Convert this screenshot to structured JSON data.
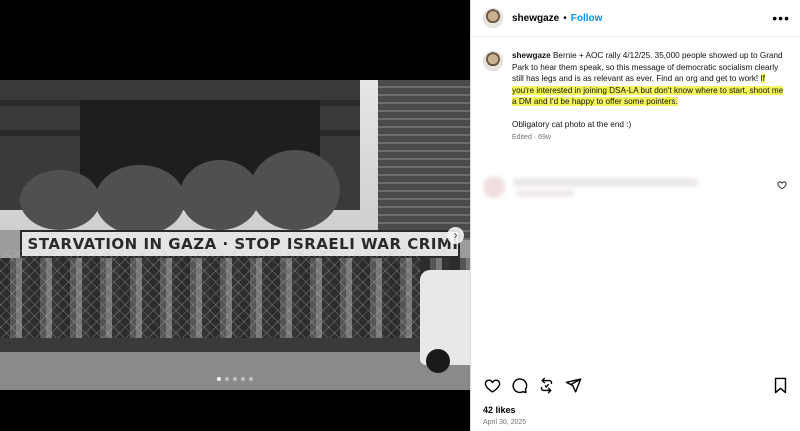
{
  "header": {
    "username": "shewgaze",
    "separator": "•",
    "follow_label": "Follow",
    "more_label": "•••"
  },
  "caption": {
    "username": "shewgaze",
    "text_plain": " Bernie + AOC rally 4/12/25. 35,000 people showed up to Grand Park to hear them speak, so this message of democratic socialism clearly still has legs and is as relevant as ever. Find an org and get to work! ",
    "text_highlighted": "If you're interested in joining DSA-LA but don't know where to start, shoot me a DM and I'd be happy to offer some pointers.",
    "extra": "Obligatory cat photo at the end :)",
    "meta": "Edited · 69w"
  },
  "media": {
    "banner_text": "STOP STARVATION IN GAZA · STOP ISRAELI WAR CRIMINALS",
    "next_icon": "›",
    "carousel_count": 5,
    "carousel_active": 0
  },
  "actions": {
    "like_icon": "heart-icon",
    "comment_icon": "comment-icon",
    "repost_icon": "repost-icon",
    "share_icon": "share-icon",
    "save_icon": "bookmark-icon"
  },
  "stats": {
    "likes": "42 likes",
    "date": "April 30, 2025"
  },
  "colors": {
    "follow": "#0095f6",
    "highlight": "#f3f55a"
  }
}
